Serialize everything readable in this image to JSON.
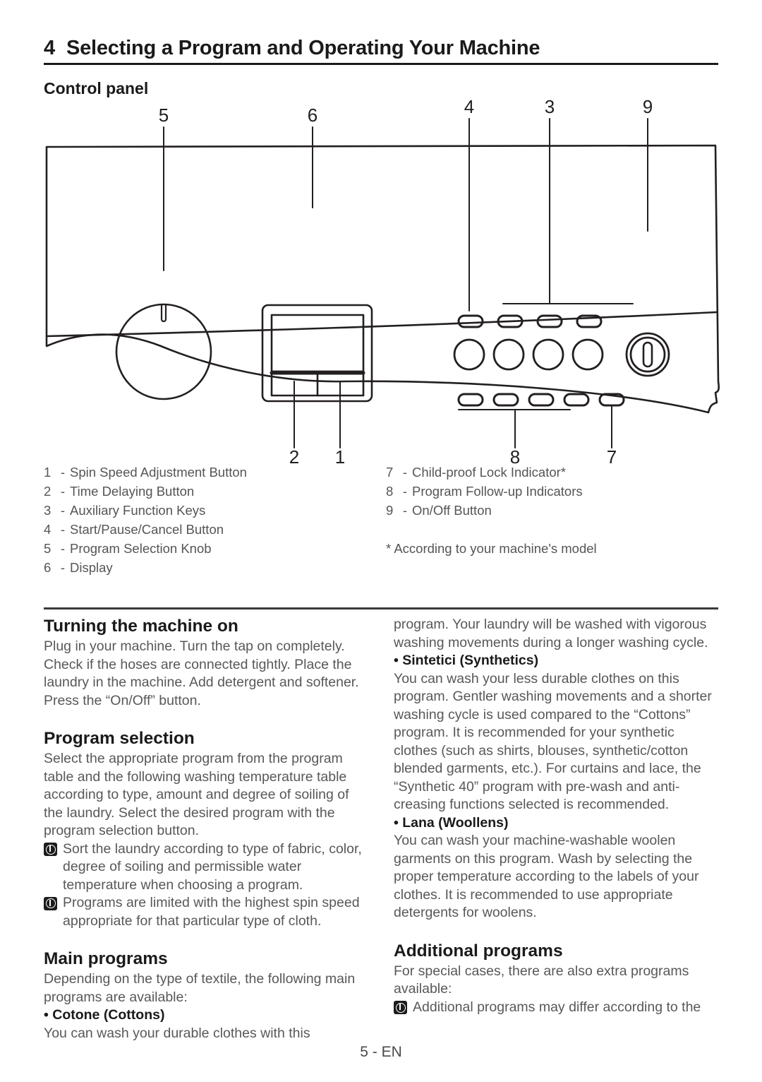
{
  "chapter": {
    "number": "4",
    "title": "Selecting a Program and Operating Your Machine"
  },
  "control_panel": {
    "heading": "Control panel",
    "callouts_top": [
      "5",
      "6",
      "4",
      "3",
      "9"
    ],
    "callouts_bottom": [
      "2",
      "1",
      "8",
      "7"
    ]
  },
  "legend": {
    "left": [
      {
        "num": "1",
        "dash": "-",
        "label": "Spin Speed Adjustment Button"
      },
      {
        "num": "2",
        "dash": "-",
        "label": "Time Delaying Button"
      },
      {
        "num": "3",
        "dash": "-",
        "label": "Auxiliary Function Keys"
      },
      {
        "num": "4",
        "dash": "-",
        "label": "Start/Pause/Cancel Button"
      },
      {
        "num": "5",
        "dash": "-",
        "label": "Program Selection Knob"
      },
      {
        "num": "6",
        "dash": "-",
        "label": "Display"
      }
    ],
    "right": [
      {
        "num": "7",
        "dash": "-",
        "label": "Child-proof Lock Indicator*"
      },
      {
        "num": "8",
        "dash": "-",
        "label": "Program Follow-up Indicators"
      },
      {
        "num": "9",
        "dash": "-",
        "label": "On/Off Button"
      }
    ],
    "footnote": "* According to your machine's model"
  },
  "left_column": {
    "turning_on_heading": "Turning the machine on",
    "turning_on_body": "Plug in your machine. Turn the tap on completely. Check if the hoses are connected tightly. Place the laundry in the machine. Add detergent and softener. Press the “On/Off” button.",
    "program_selection_heading": "Program selection",
    "program_selection_body": "Select the appropriate program from the program table and the following washing temperature table according to type, amount and degree of soiling of the laundry. Select the desired program with the program selection button.",
    "note_1": "Sort the laundry according to type of fabric, color, degree of soiling and permissible water temperature when choosing a program.",
    "note_2": "Programs are limited with the highest spin speed appropriate for that particular type of cloth.",
    "main_programs_heading": "Main programs",
    "main_programs_body": "Depending on the type of textile, the following main programs are available:",
    "cottons_bullet": "• Cotone (Cottons)",
    "cottons_body": "You can wash your durable clothes with this"
  },
  "right_column": {
    "cottons_continued": "program. Your laundry will be washed with vigorous washing movements during a longer washing cycle.",
    "synthetics_bullet": "• Sintetici (Synthetics)",
    "synthetics_body": "You can wash your less durable clothes on this program. Gentler washing movements and a shorter washing cycle is used compared to the “Cottons” program. It is recommended for your synthetic clothes (such as shirts, blouses, synthetic/cotton blended garments, etc.). For curtains and lace, the “Synthetic 40” program with pre-wash and anti-creasing functions selected is recommended.",
    "woollens_bullet": "• Lana (Woollens)",
    "woollens_body": "You can wash your machine-washable woolen garments on this program. Wash by selecting the proper temperature according to the labels of your clothes. It is recommended to use appropriate detergents for woolens.",
    "additional_heading": "Additional programs",
    "additional_body": "For special cases, there are also extra programs available:",
    "additional_note": "Additional programs may differ according to the"
  },
  "footer": {
    "page_label": "5 - EN"
  },
  "colors": {
    "ink": "#1a1a1a",
    "body_text": "#58585a",
    "line": "#231f20"
  }
}
